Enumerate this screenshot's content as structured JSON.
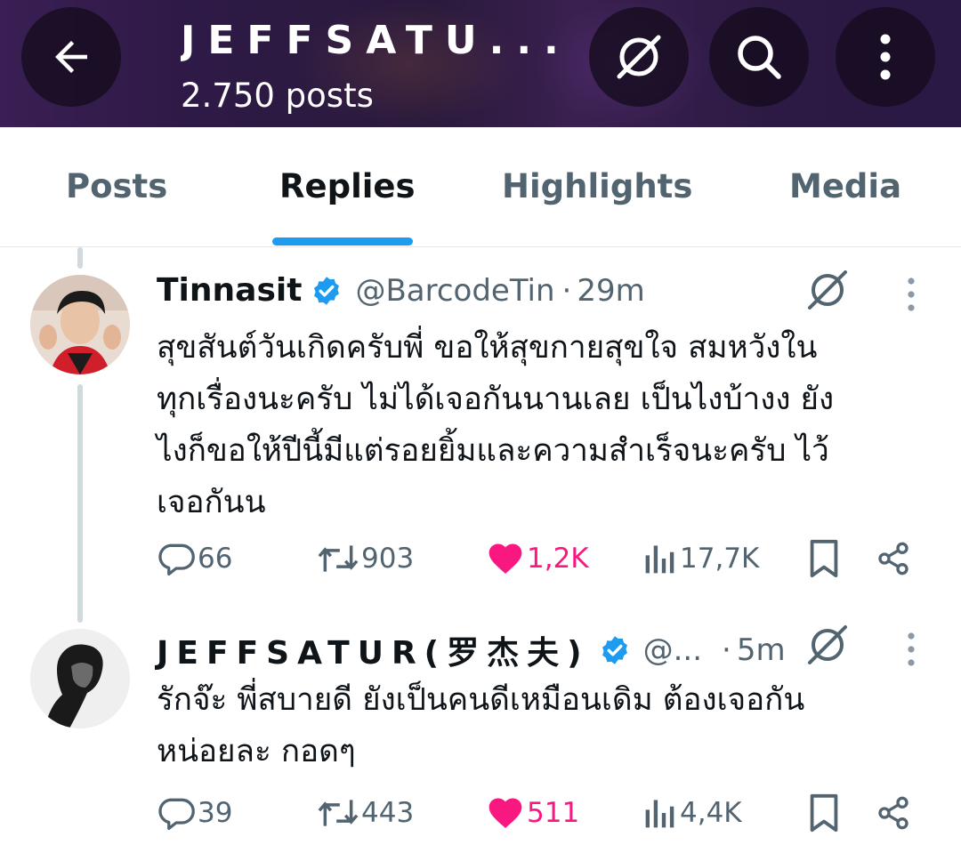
{
  "header": {
    "title": "JEFFSATU...",
    "post_count": "2.750 posts",
    "icons": [
      "back-arrow-icon",
      "grok-icon",
      "search-icon",
      "more-vertical-icon"
    ]
  },
  "tabs": [
    {
      "label": "Posts",
      "active": false
    },
    {
      "label": "Replies",
      "active": true
    },
    {
      "label": "Highlights",
      "active": false
    },
    {
      "label": "Media",
      "active": false
    }
  ],
  "colors": {
    "accent": "#1d9bf0",
    "like": "#f91880",
    "secondary_text": "#536471",
    "thread_line": "#cfd9de"
  },
  "tweets": [
    {
      "name": "Tinnasit",
      "verified": true,
      "handle": "@BarcodeTin",
      "dot": "·",
      "time": "29m",
      "text_lines": [
        "สุขสันต์วันเกิดครับพี่ ขอให้สุขกายสุขใจ สมหวังใน",
        "ทุกเรื่องนะครับ ไม่ได้เจอกันนานเลย เป็นไงบ้างง ยัง",
        "ไงก็ขอให้ปีนี้มีแต่รอยยิ้มและความสำเร็จนะครับ ไว้",
        "เจอกันน"
      ],
      "replies": "66",
      "reposts": "903",
      "likes": "1,2K",
      "liked": true,
      "views": "17,7K"
    },
    {
      "name": "JEFFSATUR(罗杰夫)",
      "verified": true,
      "handle": "@...",
      "dot": "·",
      "time": "5m",
      "text_lines": [
        "รักจ๊ะ พี่สบายดี ยังเป็นคนดีเหมือนเดิม ต้องเจอกัน",
        "หน่อยละ กอดๆ"
      ],
      "replies": "39",
      "reposts": "443",
      "likes": "511",
      "liked": true,
      "views": "4,4K"
    }
  ]
}
